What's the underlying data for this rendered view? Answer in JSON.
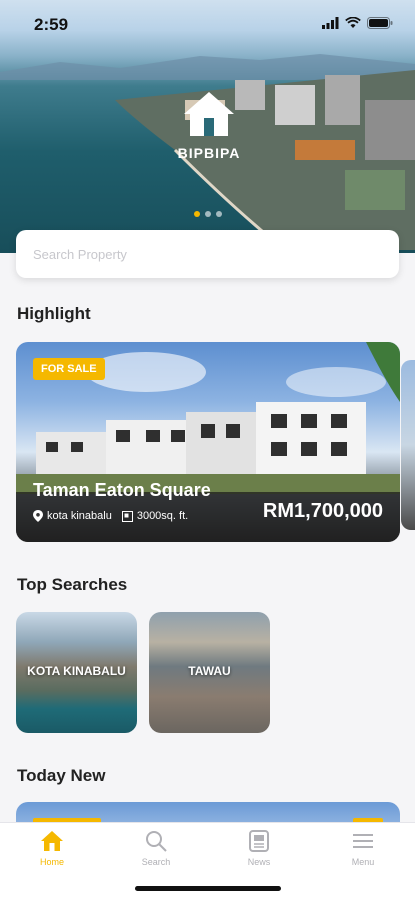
{
  "status_bar": {
    "time": "2:59"
  },
  "hero": {
    "brand": "BIPBIPA",
    "slide_count": 3,
    "active_slide": 1
  },
  "search": {
    "placeholder": "Search Property",
    "value": ""
  },
  "sections": {
    "highlight": "Highlight",
    "top_searches": "Top Searches",
    "today_new": "Today New"
  },
  "highlight_card": {
    "badge": "FOR SALE",
    "title": "Taman Eaton Square",
    "location": "kota kinabalu",
    "size": "3000sq. ft.",
    "price": "RM1,700,000"
  },
  "top_searches": [
    {
      "label": "KOTA KINABALU"
    },
    {
      "label": "TAWAU"
    }
  ],
  "tabs": [
    {
      "label": "Home",
      "icon": "home-icon",
      "active": true
    },
    {
      "label": "Search",
      "icon": "search-icon",
      "active": false
    },
    {
      "label": "News",
      "icon": "news-icon",
      "active": false
    },
    {
      "label": "Menu",
      "icon": "menu-icon",
      "active": false
    }
  ],
  "colors": {
    "accent": "#f5b800",
    "inactive": "#b0b0b5"
  }
}
